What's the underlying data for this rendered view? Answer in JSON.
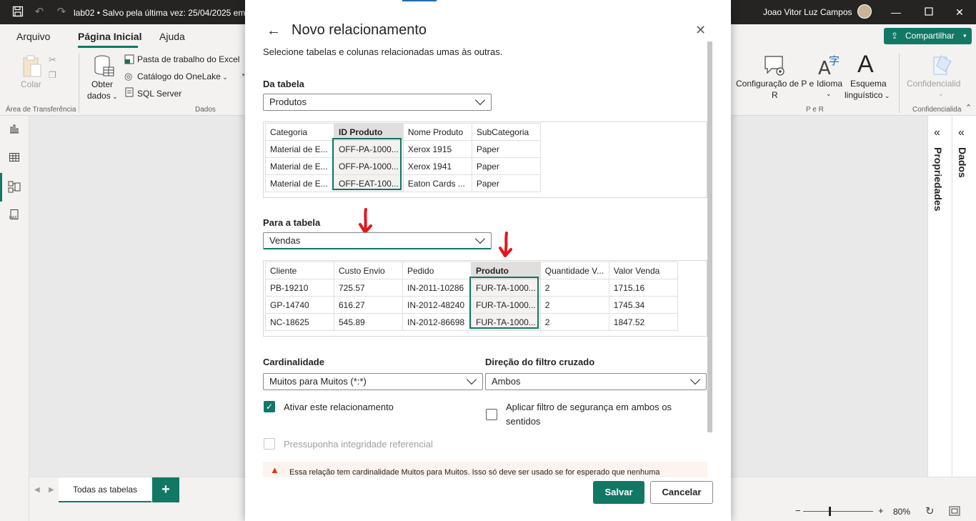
{
  "titlebar": {
    "title": "lab02 • Salvo pela última vez: 25/04/2025 em",
    "user": "Joao Vitor Luz Campos"
  },
  "ribbon": {
    "tabs": [
      {
        "label": "Arquivo"
      },
      {
        "label": "Página Inicial"
      },
      {
        "label": "Ajuda"
      }
    ],
    "share_label": "Compartilhar",
    "colar": "Colar",
    "obter": "Obter",
    "dados": "dados",
    "excel": "Pasta de trabalho do Excel",
    "onelake": "Catálogo do OneLake",
    "sql": "SQL Server",
    "config": "Configuração de P e",
    "config_r": "R",
    "idioma": "Idioma",
    "esquema": "Esquema",
    "linguistico": "linguístico",
    "confid": "Confidencialid",
    "groups": {
      "clipboard": "Área de Transferência",
      "dados": "Dados",
      "per": "P e R",
      "confid": "Confidencialida"
    }
  },
  "panes": {
    "propriedades": "Propriedades",
    "dados": "Dados"
  },
  "bottom": {
    "tab_label": "Todas as tabelas",
    "add": "+",
    "zoom": "80%"
  },
  "dialog": {
    "title": "Novo relacionamento",
    "subtitle": "Selecione tabelas e colunas relacionadas umas às outras.",
    "from_label": "Da tabela",
    "from_table": "Produtos",
    "from_grid": {
      "headers": [
        "Categoria",
        "ID Produto",
        "Nome Produto",
        "SubCategoria"
      ],
      "rows": [
        [
          "Material de E...",
          "OFF-PA-1000...",
          "Xerox 1915",
          "Paper"
        ],
        [
          "Material de E...",
          "OFF-PA-1000...",
          "Xerox 1941",
          "Paper"
        ],
        [
          "Material de E...",
          "OFF-EAT-100...",
          "Eaton Cards ...",
          "Paper"
        ]
      ]
    },
    "to_label": "Para a tabela",
    "to_table": "Vendas",
    "to_grid": {
      "headers": [
        "Cliente",
        "Custo Envio",
        "Pedido",
        "Produto",
        "Quantidade V...",
        "Valor Venda"
      ],
      "rows": [
        [
          "PB-19210",
          "725.57",
          "IN-2011-10286",
          "FUR-TA-1000...",
          "2",
          "1715.16"
        ],
        [
          "GP-14740",
          "616.27",
          "IN-2012-48240",
          "FUR-TA-1000...",
          "2",
          "1745.34"
        ],
        [
          "NC-18625",
          "545.89",
          "IN-2012-86698",
          "FUR-TA-1000...",
          "2",
          "1847.52"
        ]
      ]
    },
    "cardinality_label": "Cardinalidade",
    "cardinality_value": "Muitos para Muitos (*:*)",
    "cross_filter_label": "Direção do filtro cruzado",
    "cross_filter_value": "Ambos",
    "activate_label": "Ativar este relacionamento",
    "security_label_1": "Aplicar filtro de segurança em ambos os",
    "security_label_2": "sentidos",
    "integrity_label": "Pressuponha integridade referencial",
    "warning": "Essa relação tem cardinalidade Muitos para Muitos. Isso só deve ser usado se for esperado que nenhuma",
    "save": "Salvar",
    "cancel": "Cancelar"
  }
}
